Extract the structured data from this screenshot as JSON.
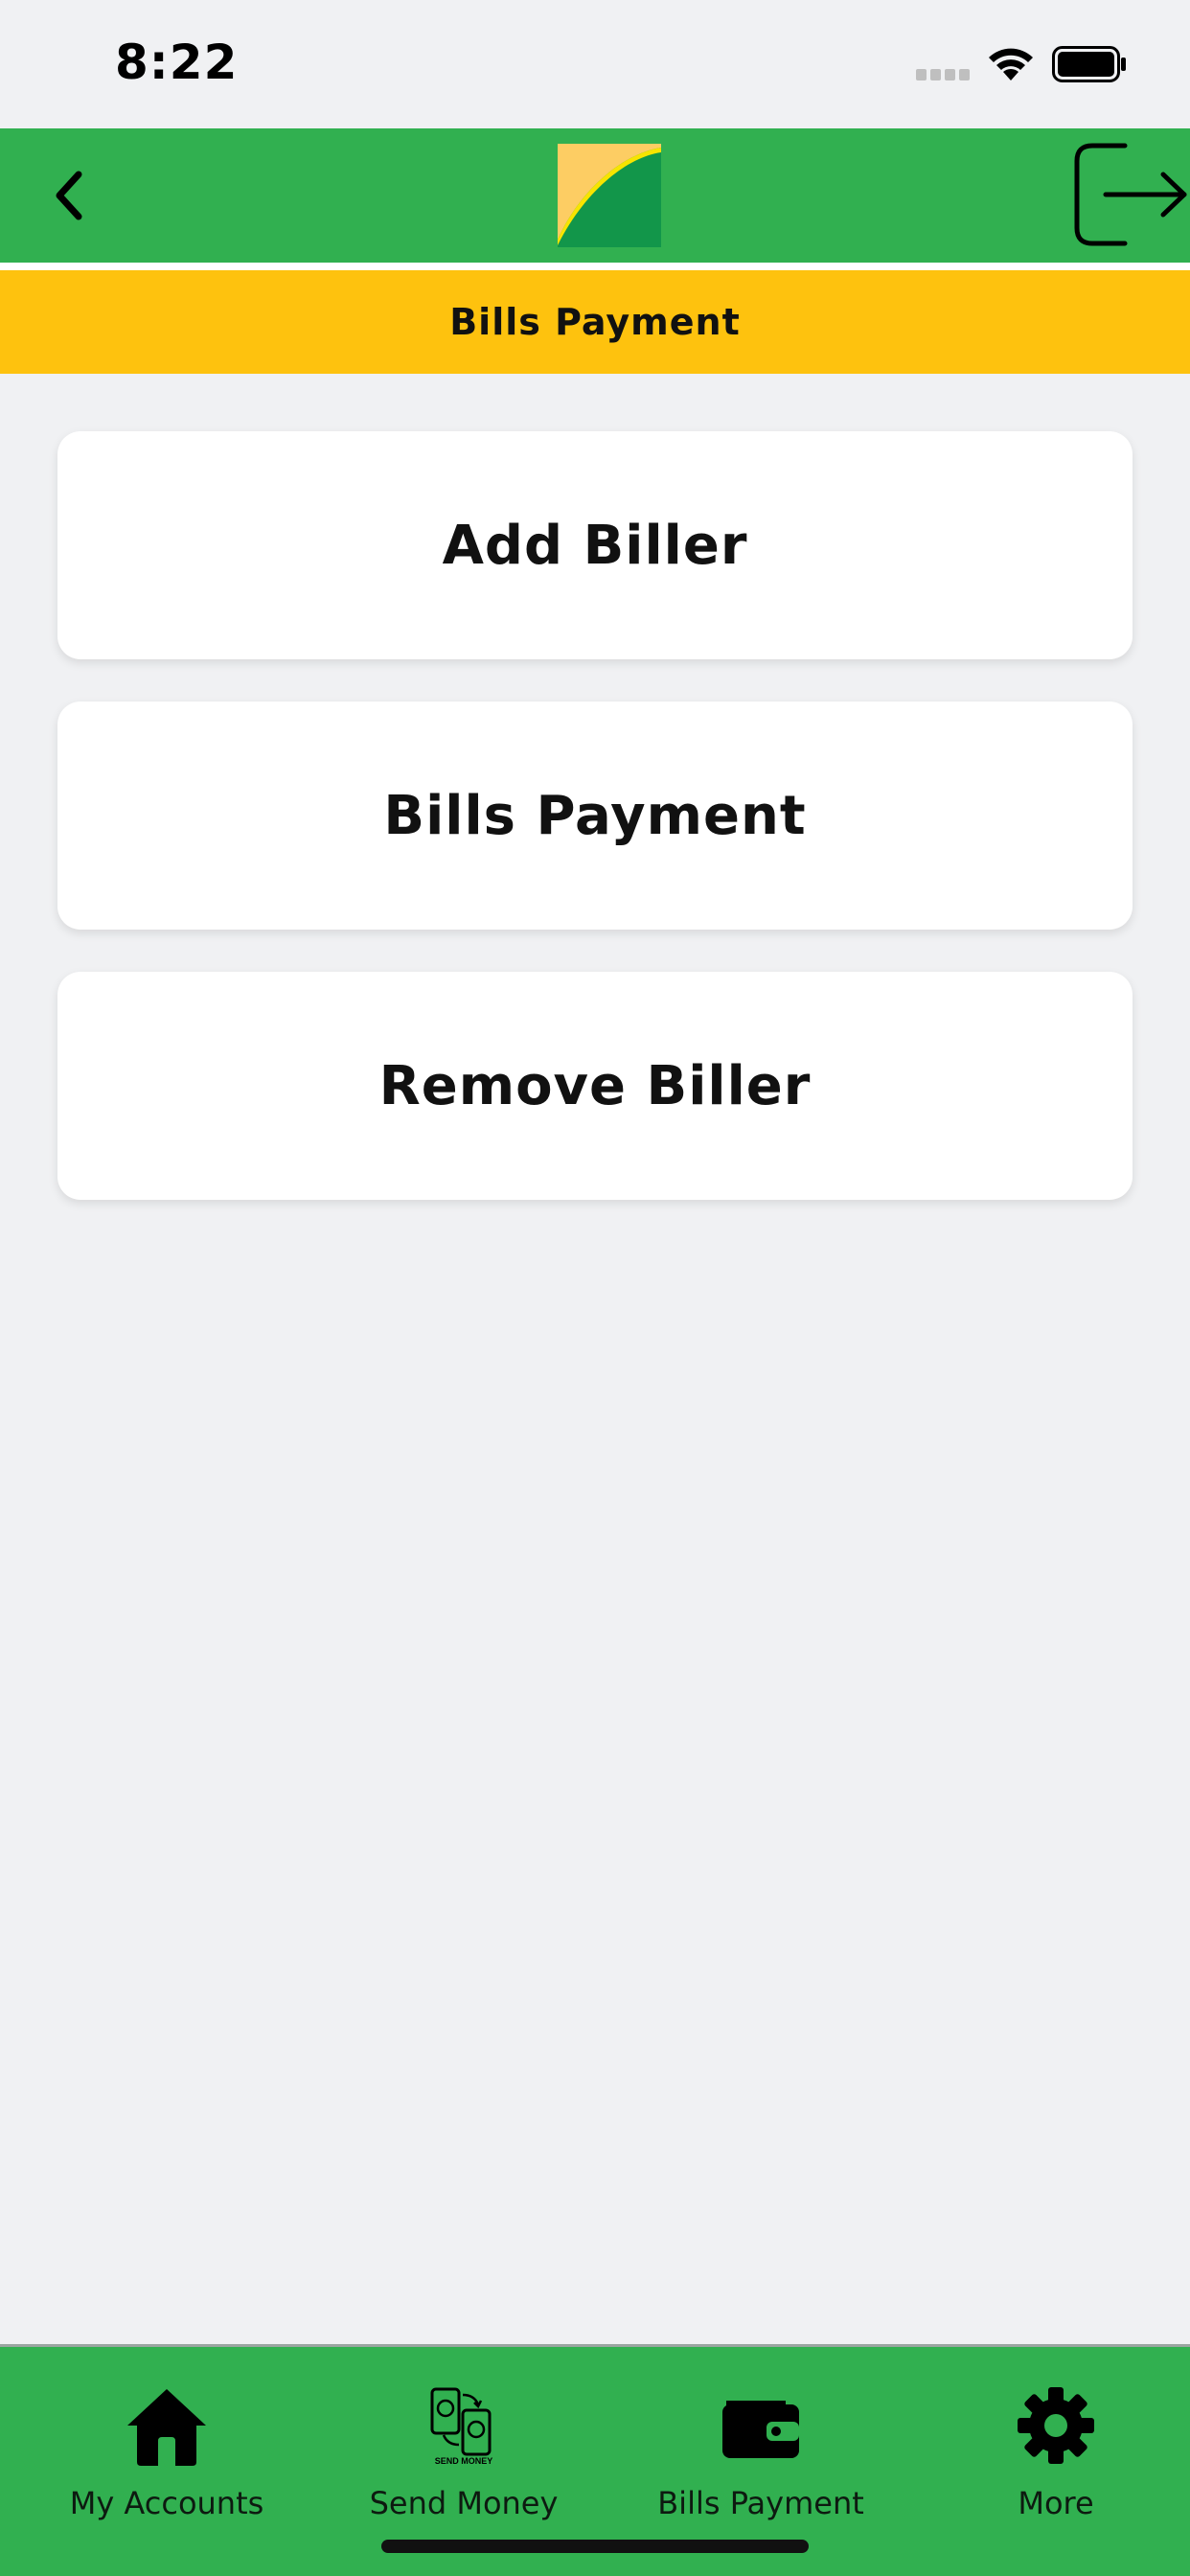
{
  "status_bar": {
    "time": "8:22"
  },
  "header": {
    "back_icon": "chevron-left-icon",
    "logout_icon": "logout-icon",
    "logo_colors": {
      "green": "#12964A",
      "yellow": "#FDCD63"
    }
  },
  "title_bar": {
    "title": "Bills Payment"
  },
  "options": [
    {
      "label": "Add Biller"
    },
    {
      "label": "Bills Payment"
    },
    {
      "label": "Remove Biller"
    }
  ],
  "tab_bar": {
    "items": [
      {
        "label": "My Accounts",
        "icon": "home-icon"
      },
      {
        "label": "Send Money",
        "icon": "send-money-icon",
        "icon_text": "SEND MONEY"
      },
      {
        "label": "Bills Payment",
        "icon": "wallet-icon"
      },
      {
        "label": "More",
        "icon": "gear-icon"
      }
    ]
  },
  "colors": {
    "header_green": "#31B050",
    "title_yellow": "#FEC20E",
    "background": "#F0F1F3"
  }
}
